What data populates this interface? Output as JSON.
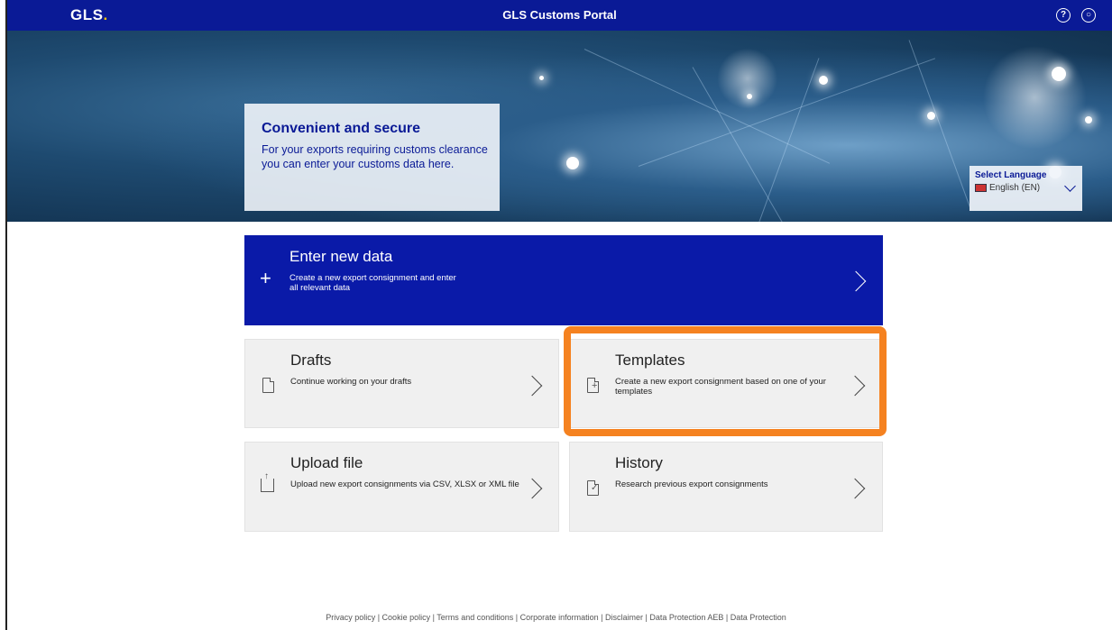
{
  "header": {
    "logo": "GLS",
    "logo_dot": ".",
    "title": "GLS Customs Portal",
    "icons": [
      "help-icon",
      "user-icon"
    ]
  },
  "hero": {
    "title": "Convenient and secure",
    "text": "For your exports requiring customs clearance you can enter your customs data here."
  },
  "language": {
    "label": "Select Language",
    "value": "English (EN)"
  },
  "tiles": {
    "enter_new": {
      "title": "Enter new data",
      "desc": "Create a new export consignment and enter all relevant data",
      "icon": "plus-icon"
    },
    "drafts": {
      "title": "Drafts",
      "desc": "Continue working on your drafts",
      "icon": "document-icon"
    },
    "templates": {
      "title": "Templates",
      "desc": "Create a new export consignment based on one of your templates",
      "icon": "document-add-icon"
    },
    "upload": {
      "title": "Upload file",
      "desc": "Upload new export consignments via CSV, XLSX or XML file",
      "icon": "upload-icon"
    },
    "history": {
      "title": "History",
      "desc": "Research previous export consignments",
      "icon": "document-check-icon"
    }
  },
  "footer": {
    "links": "Privacy policy | Cookie policy | Terms and conditions | Corporate information | Disclaimer | Data Protection AEB | Data Protection"
  },
  "colors": {
    "brand_blue": "#0a1a96",
    "highlight": "#f58220",
    "tile_grey": "#f0f0f0"
  }
}
